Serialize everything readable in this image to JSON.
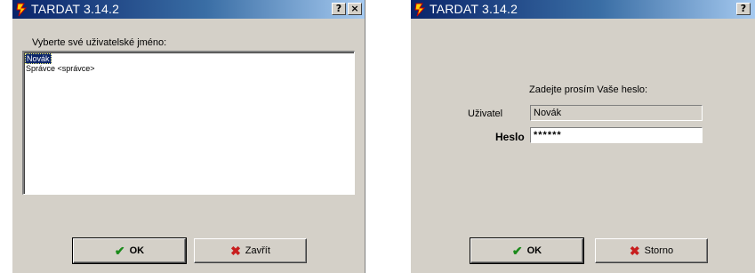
{
  "colors": {
    "accent": "#0a246a",
    "ok_icon": "#1a8a1a",
    "cancel_icon": "#c81e1e",
    "face": "#d4d0c8"
  },
  "login_window": {
    "title": "TARDAT 3.14.2",
    "help_button": "?",
    "close_button": "×",
    "prompt": "Vyberte své uživatelské jméno:",
    "users": [
      "Novák",
      "Správce <správce>"
    ],
    "selected_user": "Novák",
    "ok_label": "OK",
    "close_label": "Zavřít",
    "ok_icon": "check-icon",
    "close_icon": "cross-icon"
  },
  "password_window": {
    "title": "TARDAT 3.14.2",
    "help_button": "?",
    "prompt": "Zadejte prosím Vaše heslo:",
    "user_label": "Uživatel",
    "user_value": "Novák",
    "password_label": "Heslo",
    "password_value": "******",
    "ok_label": "OK",
    "cancel_label": "Storno",
    "ok_icon": "check-icon",
    "cancel_icon": "cross-icon"
  }
}
